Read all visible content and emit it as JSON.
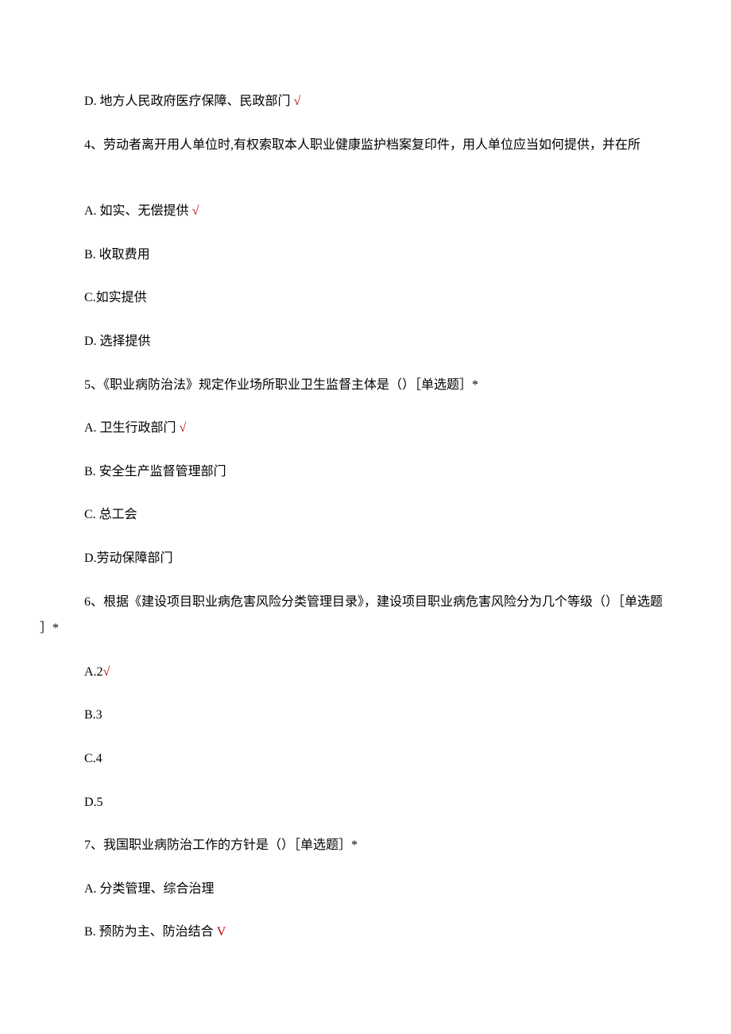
{
  "q3": {
    "optionD": "D. 地方人民政府医疗保障、民政部门",
    "mark": "√"
  },
  "q4": {
    "stem": "4、劳动者离开用人单位时,有权索取本人职业健康监护档案复印件，用人单位应当如何提供，并在所",
    "optionA": "A. 如实、无偿提供",
    "markA": "√",
    "optionB": "B. 收取费用",
    "optionC": "C.如实提供",
    "optionD": "D. 选择提供"
  },
  "q5": {
    "stem": "5、《职业病防治法》规定作业场所职业卫生监督主体是（）［单选题］*",
    "optionA": "A. 卫生行政部门",
    "markA": "√",
    "optionB": "B. 安全生产监督管理部门",
    "optionC": "C. 总工会",
    "optionD": "D.劳动保障部门"
  },
  "q6": {
    "stem_line1": "6、根据《建设项目职业病危害风险分类管理目录》，建设项目职业病危害风险分为几个等级（）［单选题",
    "stem_line2": "］*",
    "optionA_prefix": "A.2",
    "markA": "√",
    "optionB": "B.3",
    "optionC": "C.4",
    "optionD": "D.5"
  },
  "q7": {
    "stem": "7、我国职业病防治工作的方针是（）［单选题］*",
    "optionA": "A. 分类管理、综合治理",
    "optionB": "B. 预防为主、防治结合",
    "markB": "V"
  }
}
